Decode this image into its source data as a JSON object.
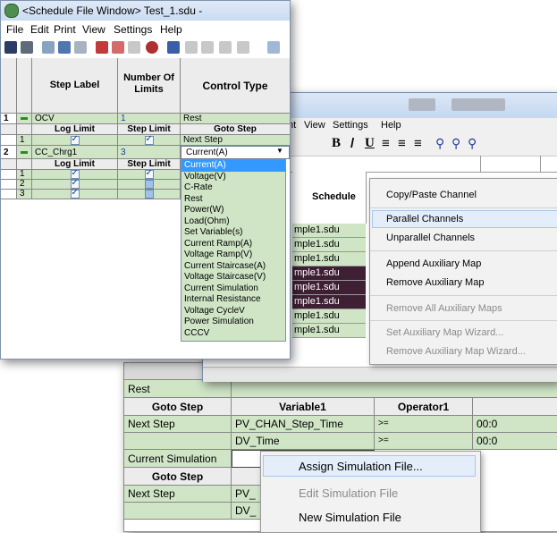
{
  "win1": {
    "title": "<Schedule File Window>  Test_1.sdu -",
    "menu": [
      "File",
      "Edit",
      "Print",
      "View",
      "Settings",
      "Help"
    ],
    "headers": [
      "Step Label",
      "Number Of Limits",
      "Control Type"
    ],
    "rows": [
      {
        "num": "1",
        "label": "OCV",
        "limits": "1",
        "ctype": "Rest"
      },
      {
        "col2": "Log Limit",
        "col3": "Step Limit",
        "col4": "Goto Step"
      },
      {
        "num": "1",
        "goto": "Next Step"
      },
      {
        "num": "2",
        "label": "CC_Chrg1",
        "limits": "3",
        "ctype": "Current(A)"
      },
      {
        "col2": "Log Limit",
        "col3": "Step Limit"
      },
      {
        "num": "1"
      },
      {
        "num": "2"
      },
      {
        "num": "3"
      }
    ],
    "dropdown_options": [
      "Current(A)",
      "Voltage(V)",
      "C-Rate",
      "Rest",
      "Power(W)",
      "Load(Ohm)",
      "Set Variable(s)",
      "Current Ramp(A)",
      "Voltage Ramp(V)",
      "Current Staircase(A)",
      "Voltage Staircase(V)",
      "Current Simulation",
      "Internal Resistance",
      "Voltage CycleV",
      "Power Simulation",
      "CCCV"
    ]
  },
  "win2": {
    "menu": [
      "nt",
      "View",
      "Settings",
      "Help"
    ],
    "column_header": "Schedule",
    "files": [
      "mple1.sdu",
      "mple1.sdu",
      "mple1.sdu",
      "mple1.sdu",
      "mple1.sdu",
      "mple1.sdu",
      "mple1.sdu",
      "mple1.sdu"
    ],
    "context_menu": [
      {
        "label": "Copy/Paste Channel",
        "disabled": false
      },
      {
        "label": "Parallel Channels",
        "disabled": false,
        "highlight": true
      },
      {
        "label": "Unparallel Channels",
        "disabled": false
      },
      {
        "label": "Append Auxiliary Map",
        "disabled": false
      },
      {
        "label": "Remove Auxiliary Map",
        "disabled": false
      },
      {
        "label": "Remove All Auxiliary Maps",
        "disabled": true
      },
      {
        "label": "Set Auxiliary Map Wizard...",
        "disabled": true
      },
      {
        "label": "Remove Auxiliary Map Wizard...",
        "disabled": true
      }
    ]
  },
  "win3": {
    "row_rest": "Rest",
    "headers": [
      "Goto Step",
      "Variable1",
      "Operator1"
    ],
    "r1": {
      "goto": "Next Step",
      "var": "PV_CHAN_Step_Time",
      "op": ">=",
      "val": "00:0"
    },
    "r2": {
      "var": "DV_Time",
      "op": ">=",
      "val": "00:0"
    },
    "row_sim": "Current Simulation",
    "goto_step_2": "Goto Step",
    "r3": {
      "goto": "Next Step",
      "var": "PV_"
    },
    "r4": {
      "var": "DV_"
    },
    "context_menu": [
      {
        "label": "Assign Simulation File...",
        "disabled": false
      },
      {
        "label": "Edit Simulation File",
        "disabled": true
      },
      {
        "label": "New Simulation File",
        "disabled": false
      }
    ]
  },
  "colors": {
    "row_green": "#cfe5c6",
    "highlight_blue": "#3399ff",
    "header_gray": "#ececec",
    "window_title": "#c9dcf3"
  }
}
